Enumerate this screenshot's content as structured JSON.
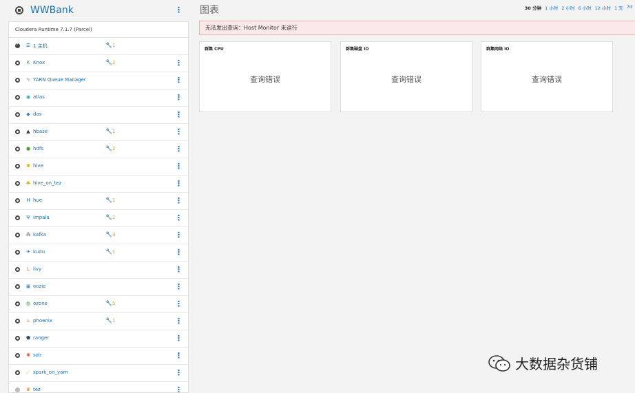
{
  "cluster": {
    "name": "WWBank",
    "runtime": "Cloudera Runtime 7.1.7 (Parcel)"
  },
  "services": [
    {
      "name": "1 主机",
      "status": "help",
      "icon": "hosts-icon",
      "glyph": "☰",
      "color": "#1a6fb5",
      "alerts": "1",
      "menu": false
    },
    {
      "name": "Knox",
      "status": "ok",
      "icon": "knox-icon",
      "glyph": "K",
      "color": "#3a9a3a",
      "alerts": "2",
      "menu": true
    },
    {
      "name": "YARN Queue Manager",
      "status": "ok",
      "icon": "yarn-queue-icon",
      "glyph": "✎",
      "color": "#999999",
      "alerts": "",
      "menu": true
    },
    {
      "name": "atlas",
      "status": "ok",
      "icon": "atlas-icon",
      "glyph": "◉",
      "color": "#2aa0a0",
      "alerts": "",
      "menu": true
    },
    {
      "name": "das",
      "status": "ok",
      "icon": "das-icon",
      "glyph": "◆",
      "color": "#3a7ac0",
      "alerts": "",
      "menu": true
    },
    {
      "name": "hbase",
      "status": "ok",
      "icon": "hbase-icon",
      "glyph": "▲",
      "color": "#333333",
      "alerts": "1",
      "menu": true
    },
    {
      "name": "hdfs",
      "status": "ok",
      "icon": "hdfs-icon",
      "glyph": "●",
      "color": "#5a9a3a",
      "alerts": "2",
      "menu": true
    },
    {
      "name": "hive",
      "status": "ok",
      "icon": "hive-icon",
      "glyph": "✱",
      "color": "#d8a800",
      "alerts": "",
      "menu": true
    },
    {
      "name": "hive_on_tez",
      "status": "ok",
      "icon": "hive-on-tez-icon",
      "glyph": "✱",
      "color": "#d8a800",
      "alerts": "",
      "menu": true
    },
    {
      "name": "hue",
      "status": "ok",
      "icon": "hue-icon",
      "glyph": "H",
      "color": "#1a6fb5",
      "alerts": "1",
      "menu": true
    },
    {
      "name": "impala",
      "status": "ok",
      "icon": "impala-icon",
      "glyph": "Ψ",
      "color": "#1a6fb5",
      "alerts": "1",
      "menu": true
    },
    {
      "name": "kafka",
      "status": "ok",
      "icon": "kafka-icon",
      "glyph": "⁂",
      "color": "#333333",
      "alerts": "3",
      "menu": true
    },
    {
      "name": "kudu",
      "status": "ok",
      "icon": "kudu-icon",
      "glyph": "✈",
      "color": "#1a6fb5",
      "alerts": "1",
      "menu": true
    },
    {
      "name": "livy",
      "status": "ok",
      "icon": "livy-icon",
      "glyph": "L",
      "color": "#e06020",
      "alerts": "",
      "menu": true
    },
    {
      "name": "oozie",
      "status": "ok",
      "icon": "oozie-icon",
      "glyph": "▣",
      "color": "#5a8ab0",
      "alerts": "",
      "menu": true
    },
    {
      "name": "ozone",
      "status": "ok",
      "icon": "ozone-icon",
      "glyph": "◍",
      "color": "#3a9a3a",
      "alerts": "5",
      "menu": true
    },
    {
      "name": "phoenix",
      "status": "ok",
      "icon": "phoenix-icon",
      "glyph": "♨",
      "color": "#e05020",
      "alerts": "1",
      "menu": true
    },
    {
      "name": "ranger",
      "status": "ok",
      "icon": "ranger-icon",
      "glyph": "⬟",
      "color": "#2a4a6a",
      "alerts": "",
      "menu": true
    },
    {
      "name": "solr",
      "status": "ok",
      "icon": "solr-icon",
      "glyph": "✺",
      "color": "#e05030",
      "alerts": "",
      "menu": true
    },
    {
      "name": "spark_on_yarn",
      "status": "ok",
      "icon": "spark-icon",
      "glyph": "☄",
      "color": "#e08020",
      "alerts": "",
      "menu": true
    },
    {
      "name": "tez",
      "status": "grey",
      "icon": "tez-icon",
      "glyph": "♛",
      "color": "#e08020",
      "alerts": "",
      "menu": true
    }
  ],
  "charts": {
    "title": "图表",
    "ranges": [
      "30 分钟",
      "1 小时",
      "2 小时",
      "6 小时",
      "12 小时",
      "1 天",
      "7d"
    ],
    "active_range": "30 分钟",
    "error_banner": "无法发出查询：Host Monitor 未运行",
    "cards": [
      {
        "title": "群集 CPU",
        "message": "查询错误"
      },
      {
        "title": "群集磁盘 IO",
        "message": "查询错误"
      },
      {
        "title": "群集网络 IO",
        "message": "查询错误"
      }
    ]
  },
  "watermark": "大数据杂货铺",
  "colors": {
    "link": "#1a6fb5",
    "alert": "#f0a030",
    "error_bg": "#fbe9e9"
  }
}
